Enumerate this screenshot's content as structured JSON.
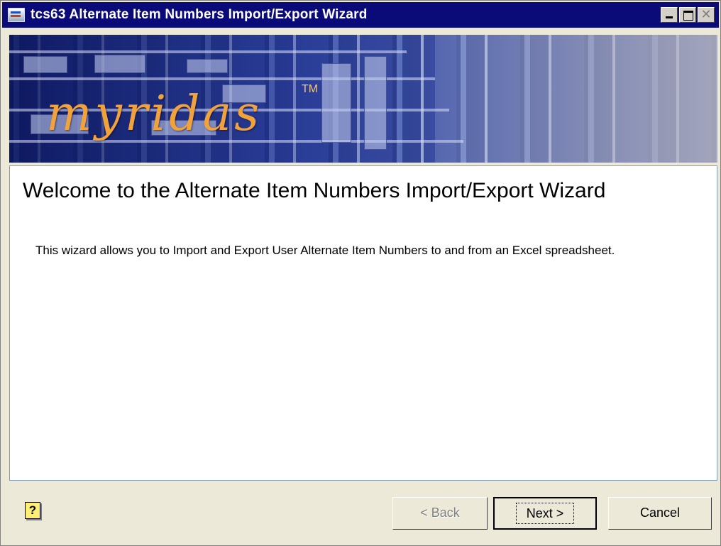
{
  "window": {
    "title": "tcs63 Alternate Item Numbers Import/Export Wizard",
    "controls": {
      "minimize": "_",
      "maximize": "□",
      "close": "✕"
    }
  },
  "banner": {
    "logo_text": "myridas",
    "trademark": "TM"
  },
  "content": {
    "heading": "Welcome to the Alternate Item Numbers Import/Export Wizard",
    "description": "This wizard allows you to Import and Export User Alternate Item Numbers to and from an Excel spreadsheet."
  },
  "footer": {
    "help_icon": "?",
    "back_label": "< Back",
    "next_label": "Next >",
    "cancel_label": "Cancel"
  },
  "colors": {
    "titlebar": "#0a0a78",
    "logo": "#f2a23c",
    "content_border": "#7f9db9"
  }
}
